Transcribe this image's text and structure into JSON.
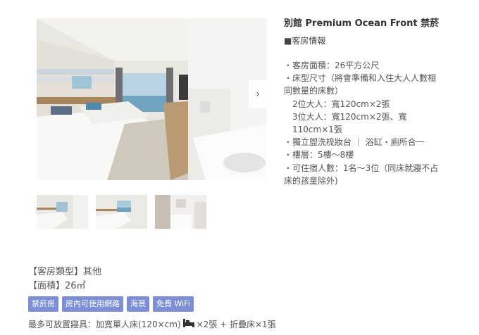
{
  "room": {
    "title": "別館 Premium Ocean Front 禁菸",
    "section_heading": "■客房情報",
    "specs": [
      "・客房面積：26平方公尺",
      "・床型尺寸（將會準備和入住大人人數相同數量的床數）",
      "2位大人：寬120cm×2張",
      "3位大人：寬120cm×2張、寬110cm×1張",
      "・獨立盥洗梳妝台 ｜ 浴缸・廁所合一",
      "・樓層：5樓〜8樓",
      "・可住宿人數：1名〜3位（同床就寢不占床的孩童除外)"
    ]
  },
  "gallery": {
    "next_icon": "chevron-right-icon",
    "thumbnails": [
      "twin-beds-room-photo",
      "twin-beds-window-photo",
      "bathroom-photo"
    ]
  },
  "details": {
    "room_type": "【客房類型】其他",
    "area": "【面積】26㎡",
    "tags": [
      "禁菸房",
      "房內可使用網路",
      "海景",
      "免費 WiFi"
    ],
    "bedding_prefix": "最多可放置寢具：加寬單人床(120×cm)",
    "bedding_suffix": "×2張 + 折疊床×1張",
    "bed_icon": "bed-icon"
  },
  "colors": {
    "tag_bg": "#7b8ed6"
  }
}
